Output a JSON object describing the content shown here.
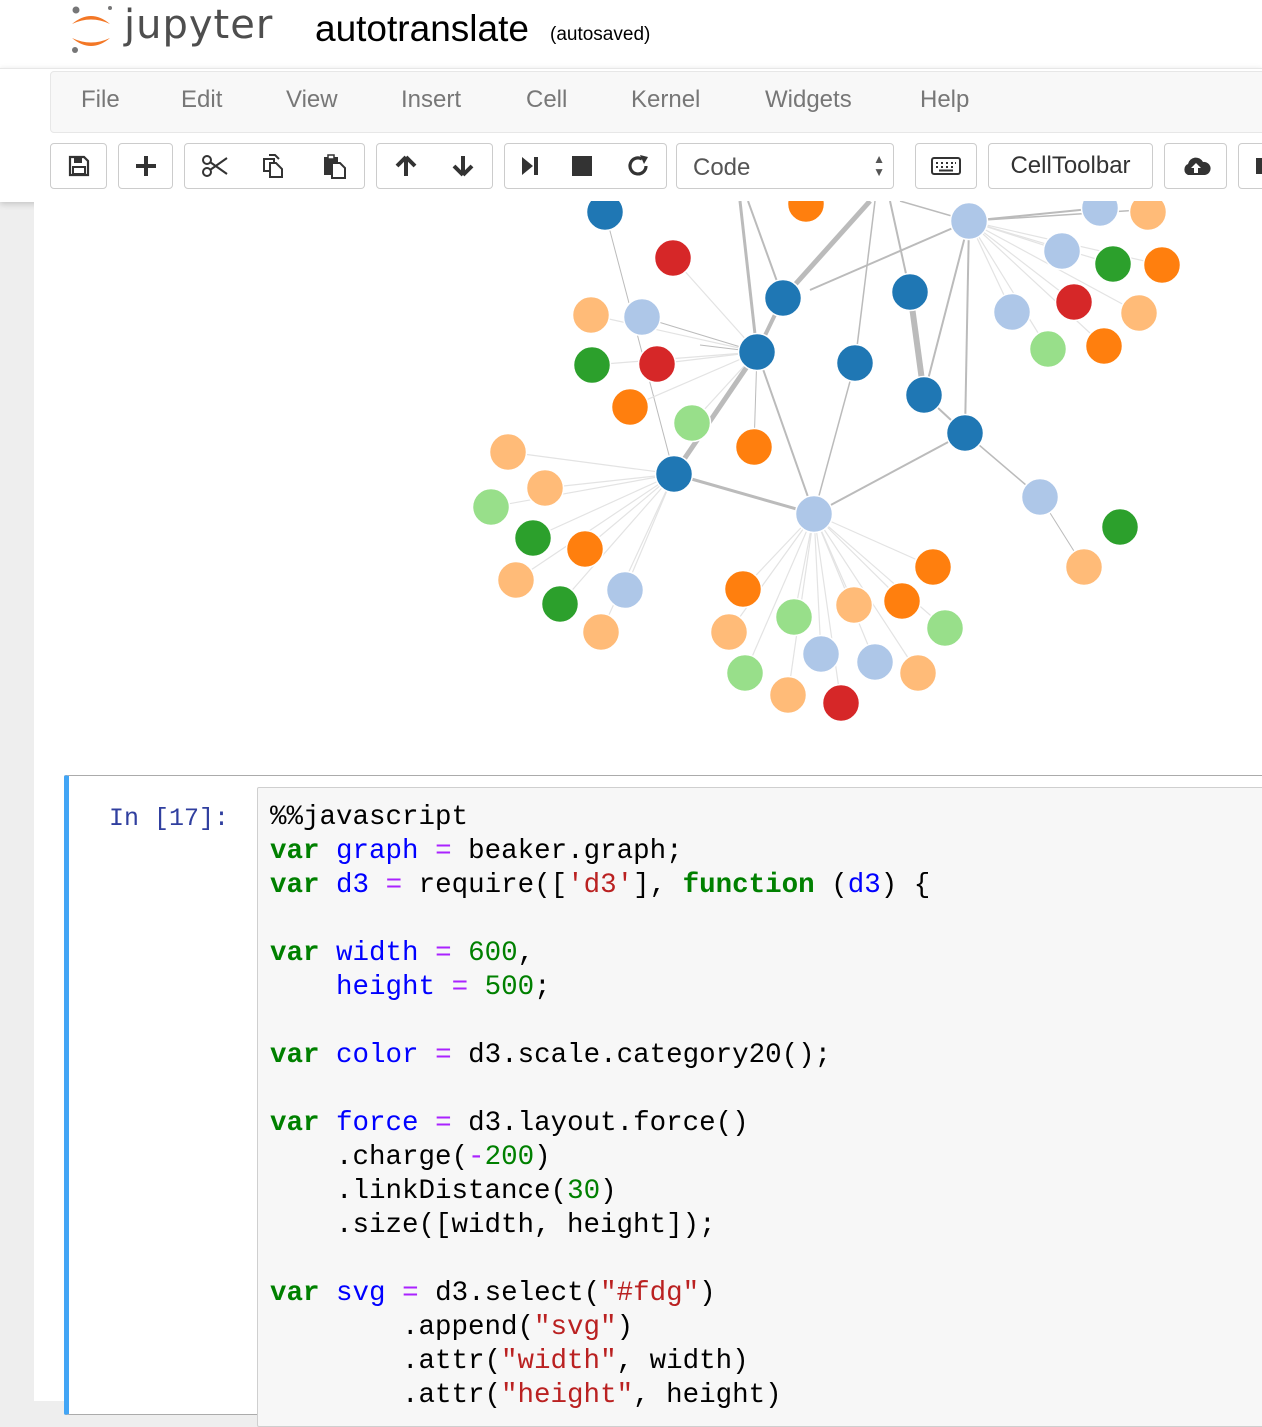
{
  "header": {
    "logo_text": "jupyter",
    "notebook_title": "autotranslate",
    "checkpoint_status": "(autosaved)"
  },
  "menu": [
    "File",
    "Edit",
    "View",
    "Insert",
    "Cell",
    "Kernel",
    "Widgets",
    "Help"
  ],
  "toolbar": {
    "buttons": [
      "save-icon",
      "plus-icon",
      "cut-icon",
      "copy-icon",
      "paste-icon",
      "arrow-up-icon",
      "arrow-down-icon",
      "run-next-icon",
      "stop-icon",
      "restart-icon"
    ],
    "cell_type": "Code",
    "keyboard_icon": "keyboard-icon",
    "celltoolbar": "CellToolbar",
    "upload_icon": "cloud-upload-icon"
  },
  "colors": {
    "dark_blue": "#1f77b4",
    "light_blue": "#aec7e8",
    "orange": "#ff7f0e",
    "light_orange": "#ffbb78",
    "green": "#2ca02c",
    "light_green": "#98df8a",
    "red": "#d62728",
    "cell_border_active": "#42a5f5",
    "prompt": "#303f9f"
  },
  "cell": {
    "prompt": "In [17]:",
    "code_lines": [
      [
        [
          "pl",
          "%%javascript"
        ]
      ],
      [
        [
          "kw",
          "var"
        ],
        [
          "pl",
          " "
        ],
        [
          "vd",
          "graph"
        ],
        [
          "pl",
          " "
        ],
        [
          "op",
          "="
        ],
        [
          "pl",
          " beaker.graph;"
        ]
      ],
      [
        [
          "kw",
          "var"
        ],
        [
          "pl",
          " "
        ],
        [
          "vd",
          "d3"
        ],
        [
          "pl",
          " "
        ],
        [
          "op",
          "="
        ],
        [
          "pl",
          " require(["
        ],
        [
          "st",
          "'d3'"
        ],
        [
          "pl",
          "], "
        ],
        [
          "kw",
          "function"
        ],
        [
          "pl",
          " ("
        ],
        [
          "vd",
          "d3"
        ],
        [
          "pl",
          ") {"
        ]
      ],
      [
        [
          "pl",
          ""
        ]
      ],
      [
        [
          "kw",
          "var"
        ],
        [
          "pl",
          " "
        ],
        [
          "vd",
          "width"
        ],
        [
          "pl",
          " "
        ],
        [
          "op",
          "="
        ],
        [
          "pl",
          " "
        ],
        [
          "nm",
          "600"
        ],
        [
          "pl",
          ","
        ]
      ],
      [
        [
          "pl",
          "    "
        ],
        [
          "vd",
          "height"
        ],
        [
          "pl",
          " "
        ],
        [
          "op",
          "="
        ],
        [
          "pl",
          " "
        ],
        [
          "nm",
          "500"
        ],
        [
          "pl",
          ";"
        ]
      ],
      [
        [
          "pl",
          ""
        ]
      ],
      [
        [
          "kw",
          "var"
        ],
        [
          "pl",
          " "
        ],
        [
          "vd",
          "color"
        ],
        [
          "pl",
          " "
        ],
        [
          "op",
          "="
        ],
        [
          "pl",
          " d3.scale.category20();"
        ]
      ],
      [
        [
          "pl",
          ""
        ]
      ],
      [
        [
          "kw",
          "var"
        ],
        [
          "pl",
          " "
        ],
        [
          "vd",
          "force"
        ],
        [
          "pl",
          " "
        ],
        [
          "op",
          "="
        ],
        [
          "pl",
          " d3.layout.force()"
        ]
      ],
      [
        [
          "pl",
          "    .charge("
        ],
        [
          "op",
          "-"
        ],
        [
          "nm",
          "200"
        ],
        [
          "pl",
          ")"
        ]
      ],
      [
        [
          "pl",
          "    .linkDistance("
        ],
        [
          "nm",
          "30"
        ],
        [
          "pl",
          ")"
        ]
      ],
      [
        [
          "pl",
          "    .size([width, height]);"
        ]
      ],
      [
        [
          "pl",
          ""
        ]
      ],
      [
        [
          "kw",
          "var"
        ],
        [
          "pl",
          " "
        ],
        [
          "vd",
          "svg"
        ],
        [
          "pl",
          " "
        ],
        [
          "op",
          "="
        ],
        [
          "pl",
          " d3.select("
        ],
        [
          "st",
          "\"#fdg\""
        ],
        [
          "pl",
          ")"
        ]
      ],
      [
        [
          "pl",
          "        .append("
        ],
        [
          "st",
          "\"svg\""
        ],
        [
          "pl",
          ")"
        ]
      ],
      [
        [
          "pl",
          "        .attr("
        ],
        [
          "st",
          "\"width\""
        ],
        [
          "pl",
          ", width)"
        ]
      ],
      [
        [
          "pl",
          "        .attr("
        ],
        [
          "st",
          "\"height\""
        ],
        [
          "pl",
          ", height)"
        ]
      ]
    ]
  }
}
